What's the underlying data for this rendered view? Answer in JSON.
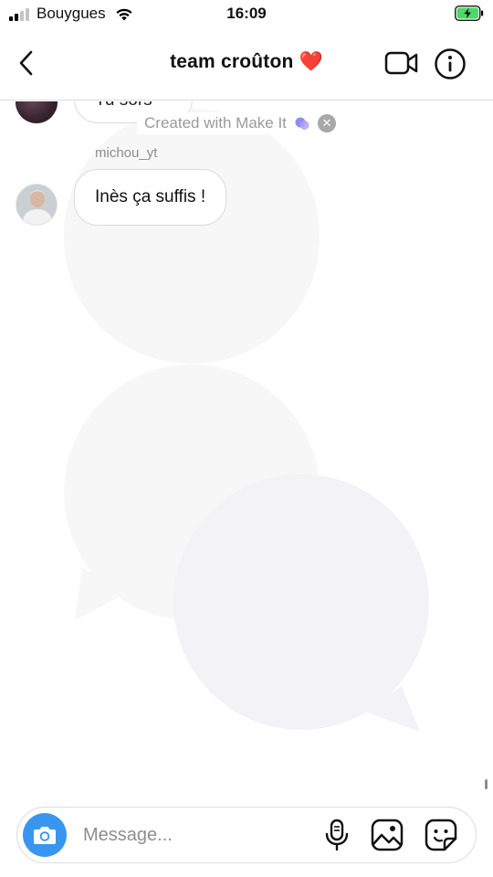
{
  "status_bar": {
    "carrier": "Bouygues",
    "time": "16:09",
    "icons": [
      "signal-icon",
      "wifi-icon",
      "battery-charging-icon"
    ]
  },
  "header": {
    "title": "team croûton",
    "title_emoji": "❤️",
    "icons": [
      "chevron-left-icon",
      "video-camera-icon",
      "info-icon"
    ]
  },
  "messages": [
    {
      "sender": "",
      "text": "Tu sors"
    },
    {
      "sender": "michou_yt",
      "text": "Inès ça suffis !"
    }
  ],
  "watermark": {
    "text": "Created with Make It"
  },
  "composer": {
    "placeholder": "Message...",
    "icons": [
      "camera-icon",
      "microphone-icon",
      "gallery-icon",
      "sticker-icon"
    ],
    "accent_color": "#3797f0"
  }
}
